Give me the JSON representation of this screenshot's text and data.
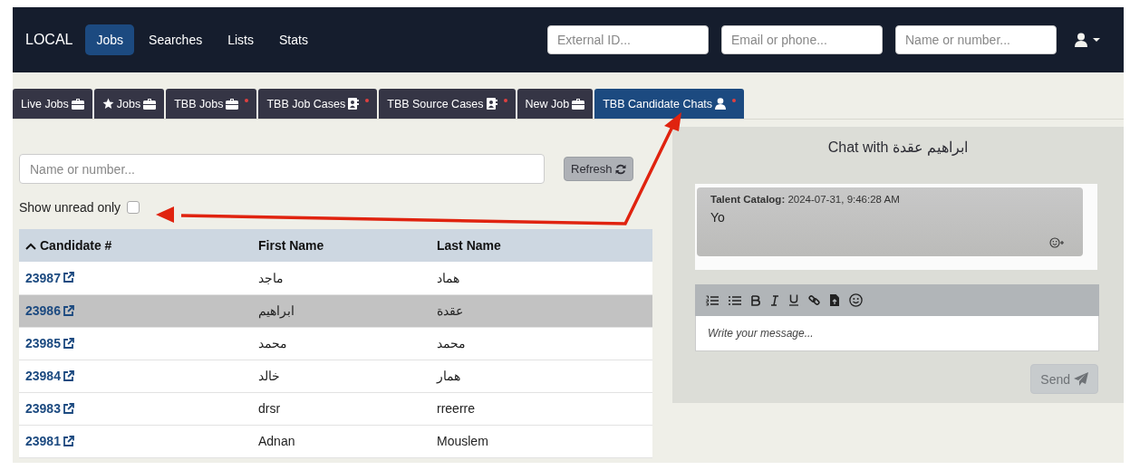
{
  "navbar": {
    "brand": "LOCAL",
    "links": [
      {
        "label": "Jobs",
        "selected": true
      },
      {
        "label": "Searches",
        "selected": false
      },
      {
        "label": "Lists",
        "selected": false
      },
      {
        "label": "Stats",
        "selected": false
      }
    ],
    "search_fields": [
      {
        "placeholder": "External ID..."
      },
      {
        "placeholder": "Email or phone..."
      },
      {
        "placeholder": "Name or number..."
      }
    ]
  },
  "tabs": [
    {
      "label": "Live Jobs",
      "kind": "jobs",
      "starred": false,
      "alert": false,
      "selected": false
    },
    {
      "label": "Jobs",
      "kind": "jobs",
      "starred": true,
      "alert": false,
      "selected": false
    },
    {
      "label": "TBB Jobs",
      "kind": "jobs",
      "starred": false,
      "alert": true,
      "selected": false
    },
    {
      "label": "TBB Job Cases",
      "kind": "cases",
      "starred": false,
      "alert": true,
      "selected": false
    },
    {
      "label": "TBB Source Cases",
      "kind": "cases",
      "starred": false,
      "alert": true,
      "selected": false
    },
    {
      "label": "New Job",
      "kind": "jobs",
      "starred": false,
      "alert": false,
      "selected": false
    },
    {
      "label": "TBB Candidate Chats",
      "kind": "candidates",
      "starred": false,
      "alert": true,
      "selected": true
    }
  ],
  "candidates": {
    "search": {
      "placeholder": "Name or number..."
    },
    "refresh_button": "Refresh",
    "unread_filter": {
      "label": "Show unread only",
      "checked": false
    },
    "table": {
      "columns": [
        {
          "label": "Candidate #",
          "sorted": true
        },
        {
          "label": "First Name",
          "sorted": false
        },
        {
          "label": "Last Name",
          "sorted": false
        }
      ],
      "rows": [
        {
          "number": "23987",
          "first_name": "ماجد",
          "last_name": "هماد",
          "selected": false
        },
        {
          "number": "23986",
          "first_name": "ابراهيم",
          "last_name": "عقدة",
          "selected": true
        },
        {
          "number": "23985",
          "first_name": "محمد",
          "last_name": "محمد",
          "selected": false
        },
        {
          "number": "23984",
          "first_name": "خالد",
          "last_name": "همار",
          "selected": false
        },
        {
          "number": "23983",
          "first_name": "drsr",
          "last_name": "rreerre",
          "selected": false
        },
        {
          "number": "23981",
          "first_name": "Adnan",
          "last_name": "Mouslem",
          "selected": false
        }
      ]
    }
  },
  "chat": {
    "title": "Chat with ابراهيم عقدة",
    "messages": [
      {
        "sender": "Talent Catalog:",
        "time": "2024-07-31, 9:46:28 AM",
        "text": "Yo"
      }
    ],
    "editor": {
      "placeholder": "Write your message..."
    },
    "send_button": {
      "label": "Send",
      "disabled": true
    }
  }
}
